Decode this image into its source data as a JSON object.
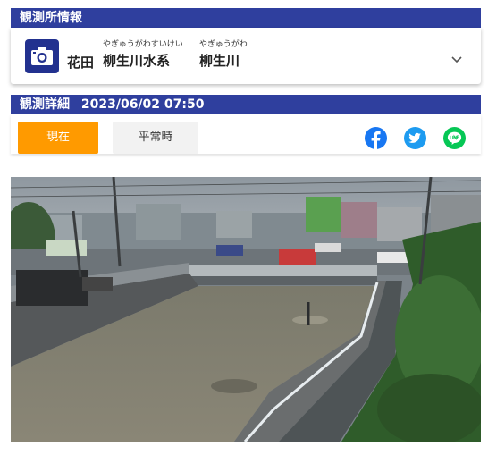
{
  "section1": {
    "title": "観測所情報"
  },
  "station": {
    "camera_icon": "camera-icon",
    "name": "花田",
    "river_system": {
      "ruby": "やぎゅうがわすいけい",
      "name": "柳生川水系"
    },
    "river": {
      "ruby": "やぎゅうがわ",
      "name": "柳生川"
    },
    "expand_icon": "chevron-down-icon"
  },
  "section2": {
    "title": "観測詳細",
    "datetime": "2023/06/02 07:50"
  },
  "tabs": [
    {
      "label": "現在",
      "active": true
    },
    {
      "label": "平常時",
      "active": false
    }
  ],
  "share": [
    {
      "icon": "facebook-icon",
      "color": "#1877f2"
    },
    {
      "icon": "twitter-icon",
      "color": "#1d9bf0"
    },
    {
      "icon": "line-icon",
      "color": "#06c755"
    }
  ],
  "colors": {
    "header": "#2f3f9e",
    "camera_box": "#22318f",
    "active_tab": "#ff9a00"
  }
}
